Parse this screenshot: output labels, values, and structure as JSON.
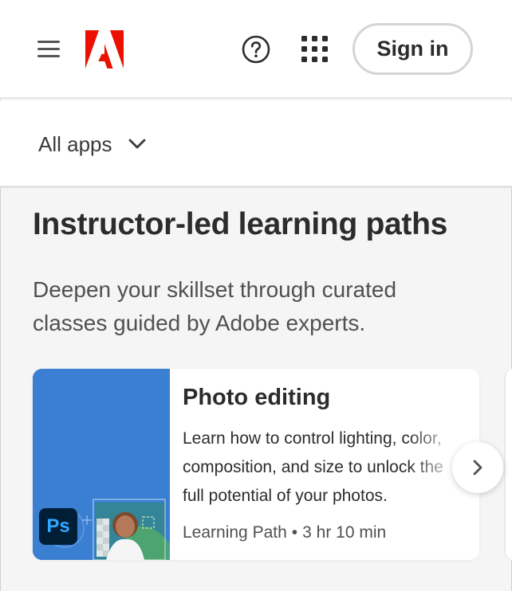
{
  "header": {
    "signin_label": "Sign in",
    "logo_icon": "adobe-logo",
    "menu_icon": "hamburger-icon",
    "help_icon": "help-icon",
    "apps_icon": "app-grid-icon",
    "brand_color": "#eb1000"
  },
  "filter": {
    "selected": "All apps",
    "icon": "chevron-down-icon"
  },
  "section": {
    "title": "Instructor-led learning paths",
    "description": "Deepen your skillset through curated classes guided by Adobe experts."
  },
  "cards": [
    {
      "title": "Photo editing",
      "description_lines": [
        "Learn how to control lighting, color,",
        "composition, and size to unlock the",
        "full potential of your photos."
      ],
      "type": "Learning Path",
      "separator": "•",
      "duration": "3 hr 10 min",
      "app_badge": "Ps",
      "thumbnail_color": "#3a7fd1"
    }
  ],
  "carousel": {
    "next_icon": "chevron-right-icon"
  }
}
